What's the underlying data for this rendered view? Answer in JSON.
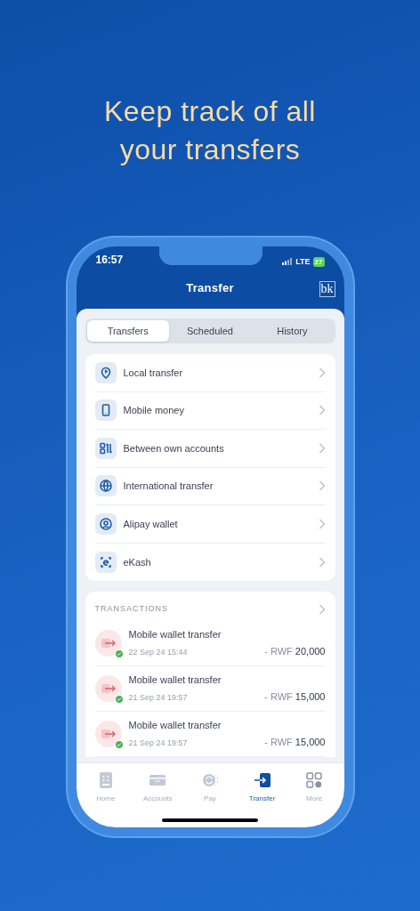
{
  "headline": {
    "lines": [
      "Keep track of all",
      "your transfers"
    ]
  },
  "status_bar": {
    "time": "16:57",
    "network": "LTE",
    "battery": "27"
  },
  "header": {
    "title": "Transfer",
    "logo": "bk"
  },
  "tabs": [
    {
      "label": "Transfers",
      "selected": true
    },
    {
      "label": "Scheduled",
      "selected": false
    },
    {
      "label": "History",
      "selected": false
    }
  ],
  "options": [
    {
      "label": "Local transfer",
      "kind": "pin"
    },
    {
      "label": "Mobile money",
      "kind": "phone"
    },
    {
      "label": "Between own accounts",
      "kind": "accounts"
    },
    {
      "label": "International transfer",
      "kind": "globe"
    },
    {
      "label": "Alipay wallet",
      "kind": "wallet"
    },
    {
      "label": "eKash",
      "kind": "ekash"
    }
  ],
  "transactions": {
    "title": "TRANSACTIONS",
    "items": [
      {
        "title": "Mobile wallet transfer",
        "date": "22 Sep 24 15:44",
        "amount": "- RWF **20,000**",
        "completed": true
      },
      {
        "title": "Mobile wallet transfer",
        "date": "21 Sep 24 19:57",
        "amount": "- RWF **15,000**",
        "completed": true
      },
      {
        "title": "Mobile wallet transfer",
        "date": "21 Sep 24 19:57",
        "amount": "- RWF **15,000**",
        "completed": true
      }
    ]
  },
  "nav": [
    {
      "label": "Home",
      "kind": "home",
      "selected": false
    },
    {
      "label": "Accounts",
      "kind": "accounts",
      "selected": false
    },
    {
      "label": "Pay",
      "kind": "pay",
      "selected": false
    },
    {
      "label": "Transfer",
      "kind": "transfer",
      "selected": true
    },
    {
      "label": "More",
      "kind": "more",
      "selected": false
    }
  ]
}
